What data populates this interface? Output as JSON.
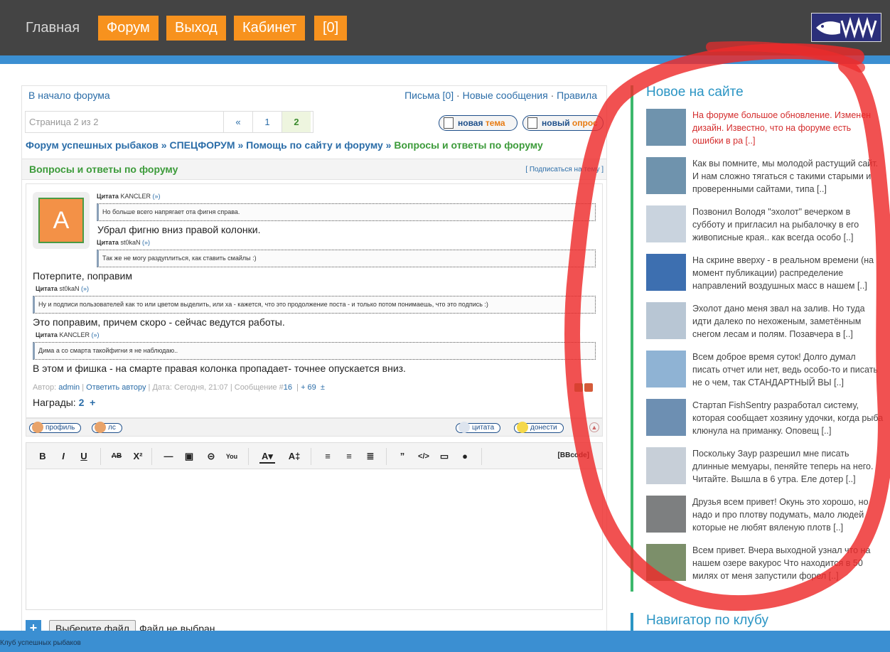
{
  "nav": {
    "home": "Главная",
    "forum": "Форум",
    "logout": "Выход",
    "cabinet": "Кабинет",
    "counter": "[0]"
  },
  "forum": {
    "back_link": "В начало форума",
    "letters": "Письма [0]",
    "new_messages": "Новые сообщения",
    "rules": "Правила",
    "page_label": "Страница 2 из 2",
    "pages": [
      "«",
      "1",
      "2"
    ],
    "new_topic_a": "новая ",
    "new_topic_b": "тема",
    "new_poll_a": "новый ",
    "new_poll_b": "опрос",
    "crumb1": "Форум успешных рыбаков",
    "crumb2": "СПЕЦФОРУМ",
    "crumb3": "Помощь по сайту и форуму",
    "crumb4": "Вопросы и ответы по форуму",
    "sep": " » ",
    "section_title": "Вопросы и ответы по форуму",
    "subscribe": "[ Подписаться на тему ]"
  },
  "post": {
    "avatar_letter": "A",
    "q1_head": "Цитата",
    "q1_author": "KANCLER",
    "q1_link": "(»)",
    "q1_text": "Но больше всего напрягает ота фигня справа.",
    "t1": "Убрал фигню вниз правой колонки.",
    "q2_head": "Цитата",
    "q2_author": "st0kaN",
    "q2_link": "(»)",
    "q2_text": "Так же не могу раздуплиться, как ставить смайлы :)",
    "t2": "Потерпите, поправим",
    "q3_head": "Цитата",
    "q3_author": "st0kaN",
    "q3_link": "(»)",
    "q3_text": "Ну и подписи пользователей как то или цветом выделить, или ха - кажется, что это продолжение поста - и только потом понимаешь, что это подпись :)",
    "t3": "Это поправим, причем скоро - сейчас ведутся работы.",
    "q4_head": "Цитата",
    "q4_author": "KANCLER",
    "q4_link": "(»)",
    "q4_text": "Дима а со смарта такойфигни я не наблюдаю..",
    "t4": "В этом и фишка - на смарте правая колонка пропадает- точнее опускается вниз.",
    "meta_author_label": "Автор:",
    "meta_author": "admin",
    "meta_reply": "Ответить автору",
    "meta_date": "Дата: Сегодня, 21:07",
    "meta_msg_label": "Сообщение #",
    "meta_msg_num": "16",
    "meta_rating": "+ 69",
    "meta_pm": "±",
    "awards_label": "Награды:",
    "awards_count": "2",
    "awards_plus": "+",
    "btn_profile": "профиль",
    "btn_pm": "лс",
    "btn_quote": "цитата",
    "btn_report": "донести"
  },
  "editor": {
    "bbcode": "[BBcode]",
    "plus": "+",
    "choose_file": "Выберите файл",
    "no_file": "Файл не выбран"
  },
  "sidebar": {
    "title": "Новое на сайте",
    "items": [
      {
        "text": "На форуме большое обновление. Изменен дизайн. Известно, что на форуме есть ошибки в ра [..]",
        "thumb": "#6f93ad"
      },
      {
        "text": "Как вы помните, мы молодой растущий сайт. И нам сложно тягаться с такими старыми и проверенными сайтами, типа [..]",
        "thumb": "#6f93ad"
      },
      {
        "text": "Позвонил Володя \"эхолот\" вечерком в субботу и пригласил на рыбалочку в его живописные края.. как всегда особо [..]",
        "thumb": "#c9d3de"
      },
      {
        "text": "На скрине вверху - в реальном времени (на момент публикации) распределение направлений воздушных масс в нашем [..]",
        "thumb": "#3d6fb0"
      },
      {
        "text": "Эхолот дано меня звал на залив. Но туда идти далеко по нехоженым, заметённым снегом лесам и полям. Позавчера в [..]",
        "thumb": "#b8c6d4"
      },
      {
        "text": "Всем доброе время суток! Долго думал писать отчет или нет, ведь особо-то и писать не о чем, так СТАНДАРТНЫЙ ВЫ [..]",
        "thumb": "#8fb3d4"
      },
      {
        "text": "Стартап FishSentry разработал систему, которая сообщает хозяину удочки, когда рыба клюнула на приманку. Оповещ [..]",
        "thumb": "#6d8fb2"
      },
      {
        "text": "Поскольку Заур разрешил мне писать длинные мемуары, пеняйте теперь на него. Читайте. Вышла в 6 утра. Еле дотер [..]",
        "thumb": "#c7cfd8"
      },
      {
        "text": "Друзья всем привет! Окунь это хорошо, но надо и про плотву подумать, мало людей которые не любят вяленую плотв [..]",
        "thumb": "#7d7f80"
      },
      {
        "text": "Всем привет. Вчера выходной узнал что на нашем озере вакурос Что находится в 50 милях от меня запустили форел [..]",
        "thumb": "#7c8f6a"
      }
    ],
    "title2": "Навигатор по клубу"
  },
  "footer": {
    "text": "Клуб успешных рыбаков"
  },
  "colors": {
    "accent_orange": "#f7921e",
    "accent_blue": "#3b8fd2",
    "sidebar_green": "#3cb86c",
    "annotation_red": "#ee2b2b"
  }
}
